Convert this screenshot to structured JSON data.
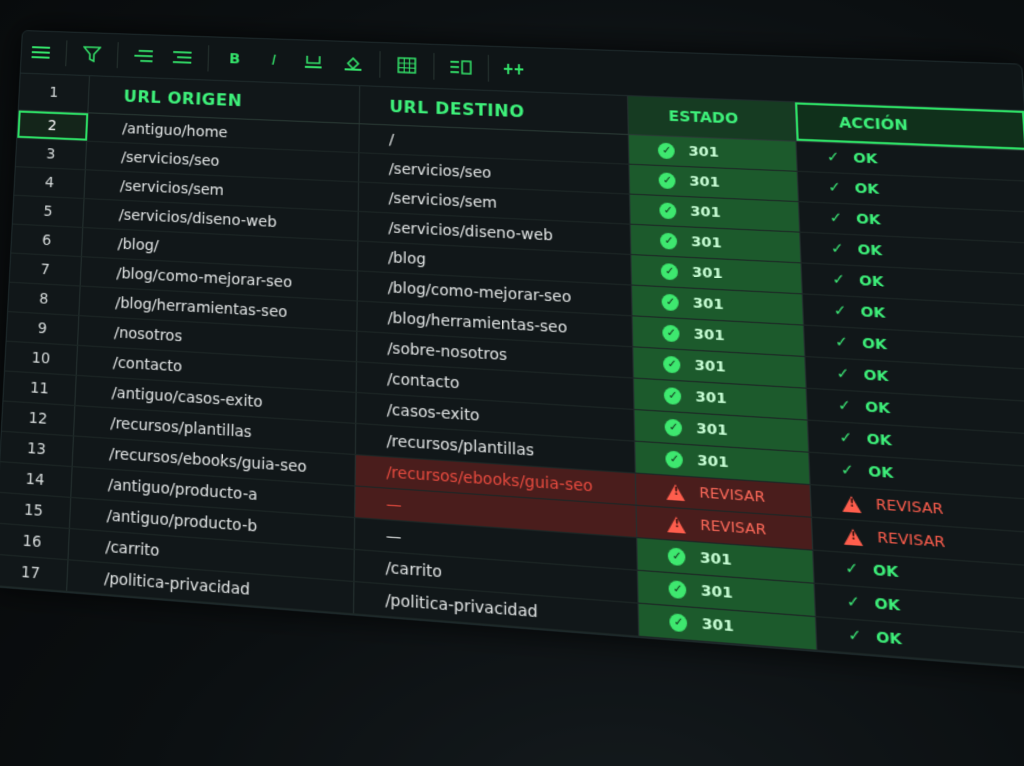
{
  "toolbar": {
    "icons": [
      "menu-icon",
      "filter-icon",
      "align-left-icon",
      "align-indent-icon",
      "bold-icon",
      "italic-icon",
      "text-color-icon",
      "fill-color-icon",
      "table-icon",
      "row-layout-icon",
      "add-column-icon"
    ],
    "bold_label": "B",
    "italic_label": "I"
  },
  "columns": {
    "header_row": "1",
    "url_origen": "URL ORIGEN",
    "url_destino": "URL DESTINO",
    "estado": "ESTADO",
    "accion": "ACCIÓN"
  },
  "rows": [
    {
      "n": "2",
      "src": "/antiguo/home",
      "dst": "/",
      "status": "301",
      "action": "OK"
    },
    {
      "n": "3",
      "src": "/servicios/seo",
      "dst": "/servicios/seo",
      "status": "301",
      "action": "OK"
    },
    {
      "n": "4",
      "src": "/servicios/sem",
      "dst": "/servicios/sem",
      "status": "301",
      "action": "OK"
    },
    {
      "n": "5",
      "src": "/servicios/diseno-web",
      "dst": "/servicios/diseno-web",
      "status": "301",
      "action": "OK"
    },
    {
      "n": "6",
      "src": "/blog/",
      "dst": "/blog",
      "status": "301",
      "action": "OK"
    },
    {
      "n": "7",
      "src": "/blog/como-mejorar-seo",
      "dst": "/blog/como-mejorar-seo",
      "status": "301",
      "action": "OK"
    },
    {
      "n": "8",
      "src": "/blog/herramientas-seo",
      "dst": "/blog/herramientas-seo",
      "status": "301",
      "action": "OK"
    },
    {
      "n": "9",
      "src": "/nosotros",
      "dst": "/sobre-nosotros",
      "status": "301",
      "action": "OK"
    },
    {
      "n": "10",
      "src": "/contacto",
      "dst": "/contacto",
      "status": "301",
      "action": "OK"
    },
    {
      "n": "11",
      "src": "/antiguo/casos-exito",
      "dst": "/casos-exito",
      "status": "301",
      "action": "OK"
    },
    {
      "n": "12",
      "src": "/recursos/plantillas",
      "dst": "/recursos/plantillas",
      "status": "301",
      "action": "OK"
    },
    {
      "n": "13",
      "src": "/recursos/ebooks/guia-seo",
      "dst": "/recursos/ebooks/guia-seo",
      "status": "REVISAR",
      "action": "REVISAR"
    },
    {
      "n": "14",
      "src": "/antiguo/producto-a",
      "dst": "—",
      "status": "REVISAR",
      "action": "REVISAR"
    },
    {
      "n": "15",
      "src": "/antiguo/producto-b",
      "dst": "—",
      "status": "301",
      "action": "OK"
    },
    {
      "n": "16",
      "src": "/carrito",
      "dst": "/carrito",
      "status": "301",
      "action": "OK"
    },
    {
      "n": "17",
      "src": "/politica-privacidad",
      "dst": "/politica-privacidad",
      "status": "301",
      "action": "OK"
    }
  ],
  "colors": {
    "accent": "#3ef07a",
    "ok_fill": "#1c5a2c",
    "warn_fill": "#4a1d1c",
    "warn_text": "#ff5e4d"
  }
}
